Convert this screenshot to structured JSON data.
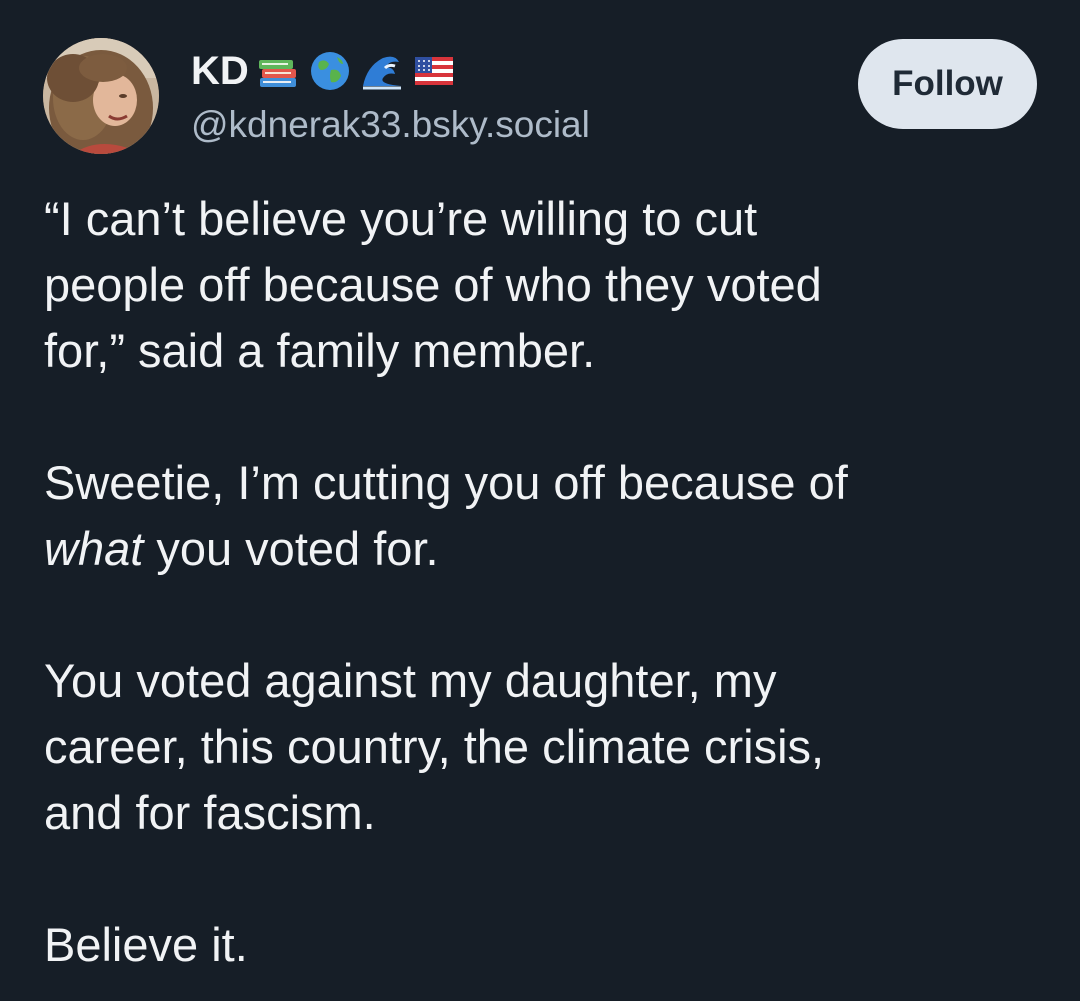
{
  "author": {
    "display_name": "KD",
    "name_emojis": [
      "books-emoji",
      "globe-emoji",
      "wave-emoji",
      "us-flag-emoji"
    ],
    "handle": "@kdnerak33.bsky.social",
    "avatar_icon": "profile-photo-avatar"
  },
  "follow_button": {
    "label": "Follow"
  },
  "post": {
    "p1": {
      "line1": "“I can’t believe you’re willing to cut",
      "line2": "people off because of who they voted",
      "line3": "for,” said a family member."
    },
    "p2": {
      "line1": "Sweetie, I’m cutting you off because of",
      "line2_italic": "what",
      "line2_rest": " you voted for."
    },
    "p3": {
      "line1": "You voted against my daughter, my",
      "line2": "career, this country, the climate crisis,",
      "line3": "and for fascism."
    },
    "p4": {
      "line1": "Believe it."
    }
  },
  "colors": {
    "background": "#161e27",
    "text": "#f1f3f5",
    "handle": "#aebbc9",
    "follow_bg": "#dfe6ee",
    "follow_text": "#1f2a36"
  }
}
